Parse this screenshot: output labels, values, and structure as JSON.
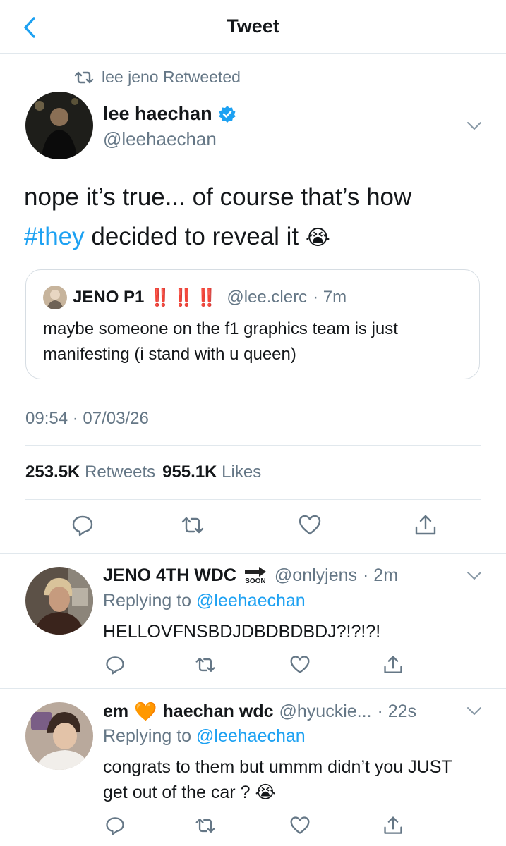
{
  "header": {
    "title": "Tweet"
  },
  "retweet": {
    "label": "lee jeno Retweeted"
  },
  "tweet": {
    "name": "lee haechan",
    "handle": "@leehaechan",
    "text_line1": "nope it’s true... of course that’s how",
    "hashtag": "#they",
    "text_line2_rest": " decided to reveal it ",
    "emoji": "😭",
    "quote": {
      "name": "JENO P1",
      "bangs": "‼️ ‼️ ‼️",
      "handle": "@lee.clerc",
      "time": "· 7m",
      "text": "maybe someone on the f1 graphics team is just manifesting (i stand with u queen)"
    },
    "timestamp": "09:54 · 07/03/26",
    "retweets_count": "253.5K",
    "retweets_label": "Retweets",
    "likes_count": "955.1K",
    "likes_label": "Likes"
  },
  "replies": [
    {
      "name": "JENO 4TH WDC",
      "badge": "SOON",
      "handle": "@onlyjens",
      "time": "· 2m",
      "replying_prefix": "Replying to",
      "replying_to": "@leehaechan",
      "text": "HELLOVFNSBDJDBDBDBDJ?!?!?!"
    },
    {
      "name": "em",
      "heart": "🧡",
      "name2": "haechan wdc",
      "handle": "@hyuckie...",
      "time": "· 22s",
      "replying_prefix": "Replying to",
      "replying_to": "@leehaechan",
      "text": "congrats to them but ummm didn’t you JUST get out of the car ?",
      "emoji": "😭"
    }
  ],
  "colors": {
    "accent": "#1da1f2",
    "muted": "#657786",
    "divider": "#e1e8ed"
  }
}
